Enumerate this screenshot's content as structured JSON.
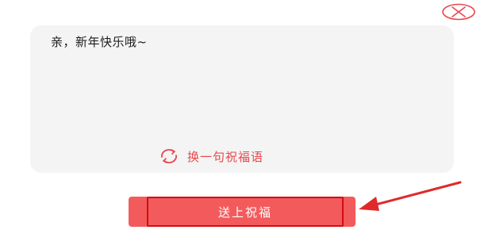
{
  "dialog": {
    "close_icon": "close-circle-x-icon",
    "message": "亲，新年快乐哦~",
    "switch_icon": "refresh-icon",
    "switch_label": "换一句祝福语",
    "send_label": "送上祝福"
  },
  "colors": {
    "accent": "#e8474c",
    "button": "#f35a5c",
    "highlight_border": "#d20d10",
    "card_bg": "#f4f4f4"
  }
}
